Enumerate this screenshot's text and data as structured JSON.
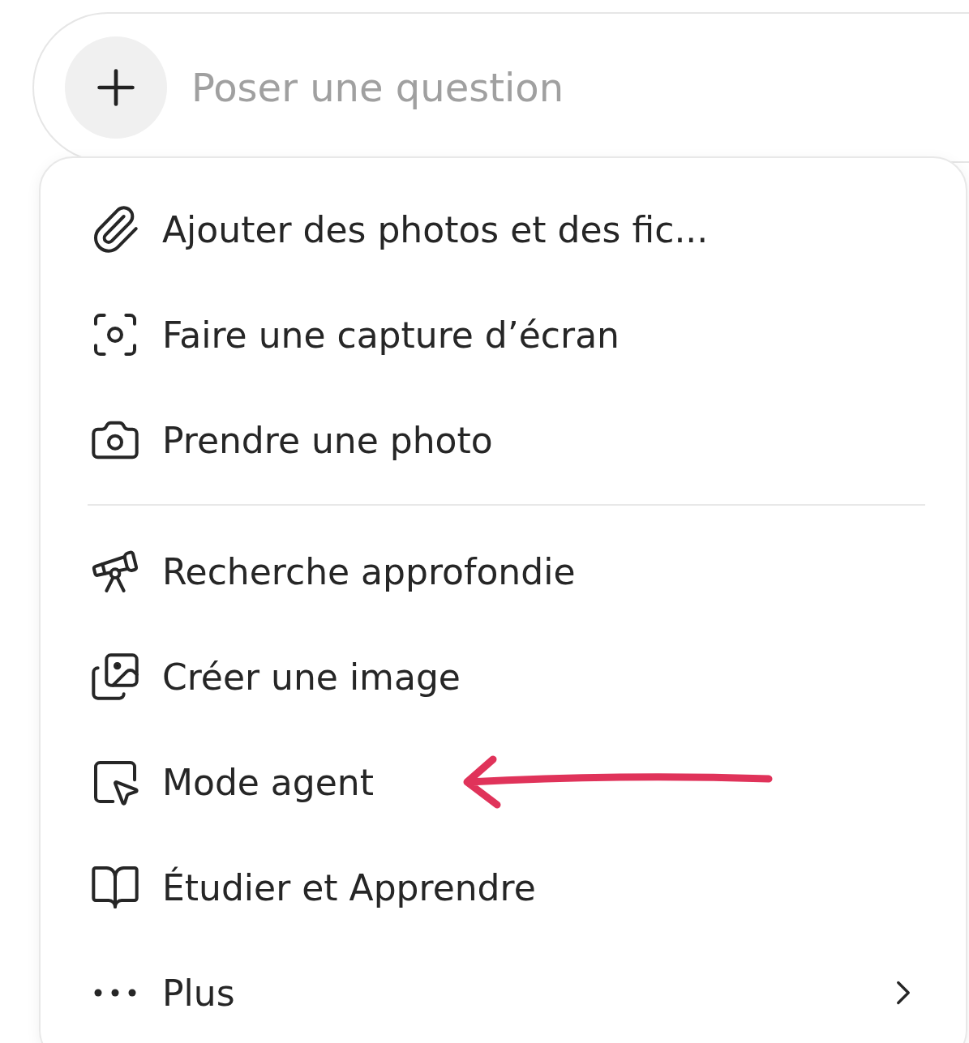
{
  "input": {
    "placeholder": "Poser une question"
  },
  "menu": {
    "sections": [
      {
        "items": [
          {
            "label": "Ajouter des photos et des fic...",
            "highlighted": false,
            "has_submenu": false
          },
          {
            "label": "Faire une capture d’écran",
            "highlighted": false,
            "has_submenu": false
          },
          {
            "label": "Prendre une photo",
            "highlighted": false,
            "has_submenu": false
          }
        ]
      },
      {
        "items": [
          {
            "label": "Recherche approfondie",
            "highlighted": false,
            "has_submenu": false
          },
          {
            "label": "Créer une image",
            "highlighted": false,
            "has_submenu": false
          },
          {
            "label": "Mode agent",
            "highlighted": true,
            "has_submenu": false
          },
          {
            "label": "Étudier et Apprendre",
            "highlighted": false,
            "has_submenu": false
          },
          {
            "label": "Plus",
            "highlighted": false,
            "has_submenu": true
          }
        ]
      }
    ]
  }
}
